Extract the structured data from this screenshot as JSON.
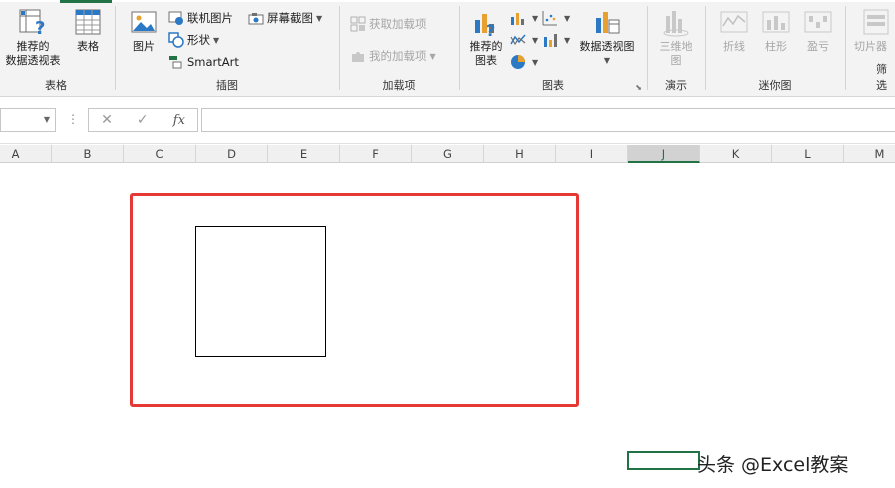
{
  "ribbon": {
    "groups": {
      "tables": {
        "label": "表格",
        "pivot_line1": "推荐的",
        "pivot_line2": "数据透视表",
        "table": "表格"
      },
      "illustrations": {
        "label": "插图",
        "picture": "图片",
        "online_picture": "联机图片",
        "shapes": "形状",
        "smartart": "SmartArt",
        "screenshot": "屏幕截图"
      },
      "addins": {
        "label": "加载项",
        "get_addins": "获取加载项",
        "my_addins": "我的加载项"
      },
      "charts": {
        "label": "图表",
        "rec_line1": "推荐的",
        "rec_line2": "图表",
        "pivot_chart": "数据透视图"
      },
      "tours": {
        "label": "演示",
        "map_line1": "三维地",
        "map_line2": "图"
      },
      "sparklines": {
        "label": "迷你图",
        "line": "折线",
        "column": "柱形",
        "winloss": "盈亏"
      },
      "filters": {
        "label": "筛选",
        "slicer": "切片器"
      }
    }
  },
  "formula_bar": {
    "namebox": "",
    "cancel": "✕",
    "enter": "✓",
    "fx": "fx",
    "value": ""
  },
  "columns": [
    "A",
    "B",
    "C",
    "D",
    "E",
    "F",
    "G",
    "H",
    "I",
    "J",
    "K",
    "L",
    "M"
  ],
  "selected_column": "J",
  "colors": {
    "accent": "#217346",
    "highlight_border": "#e53935"
  },
  "watermark": "头条 @Excel教案"
}
